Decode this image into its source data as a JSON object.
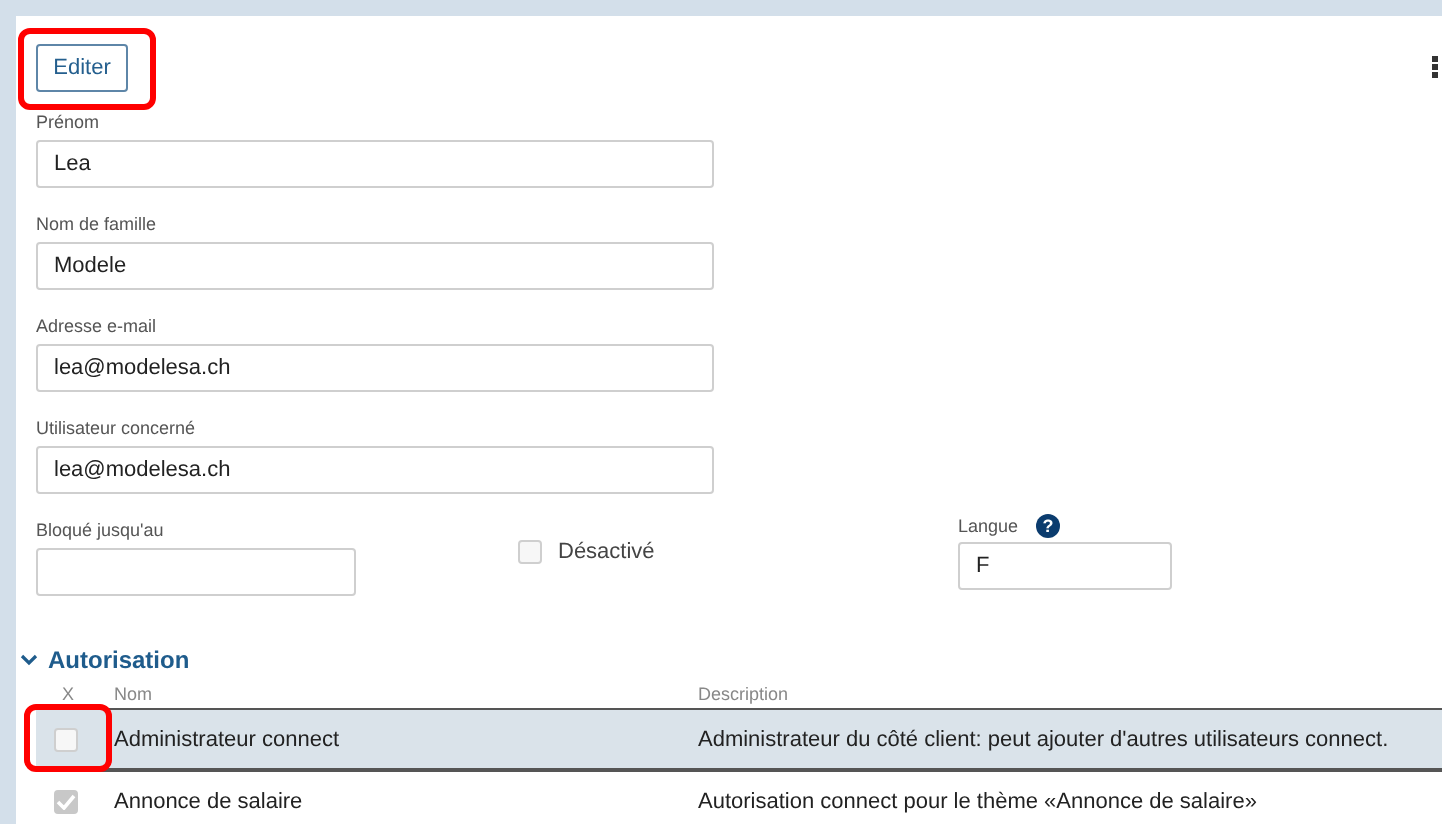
{
  "edit_button": {
    "label": "Editer",
    "highlighted": true
  },
  "fields": [
    {
      "label": "Prénom",
      "value": "Lea"
    },
    {
      "label": "Nom de famille",
      "value": "Modele"
    },
    {
      "label": "Adresse e-mail",
      "value": "lea@modelesa.ch"
    },
    {
      "label": "Utilisateur concerné",
      "value": "lea@modelesa.ch"
    }
  ],
  "blocked_until": {
    "label": "Bloqué jusqu'au"
  },
  "deactivated": {
    "label": "Désactivé",
    "checked": false
  },
  "language": {
    "label": "Langue",
    "help": "?",
    "value": "F"
  },
  "section": {
    "title": "Autorisation",
    "expanded": true
  },
  "table": {
    "columns": [
      "X",
      "Nom",
      "Description"
    ],
    "rows": [
      {
        "checked": false,
        "disabled": false,
        "selected": true,
        "highlighted": true,
        "name": "Administrateur connect",
        "description": "Administrateur du côté client: peut ajouter d'autres utilisateurs connect."
      },
      {
        "checked": true,
        "disabled": true,
        "selected": false,
        "highlighted": false,
        "name": "Annonce de salaire",
        "description": "Autorisation connect pour le thème «Annonce de salaire»"
      }
    ]
  }
}
